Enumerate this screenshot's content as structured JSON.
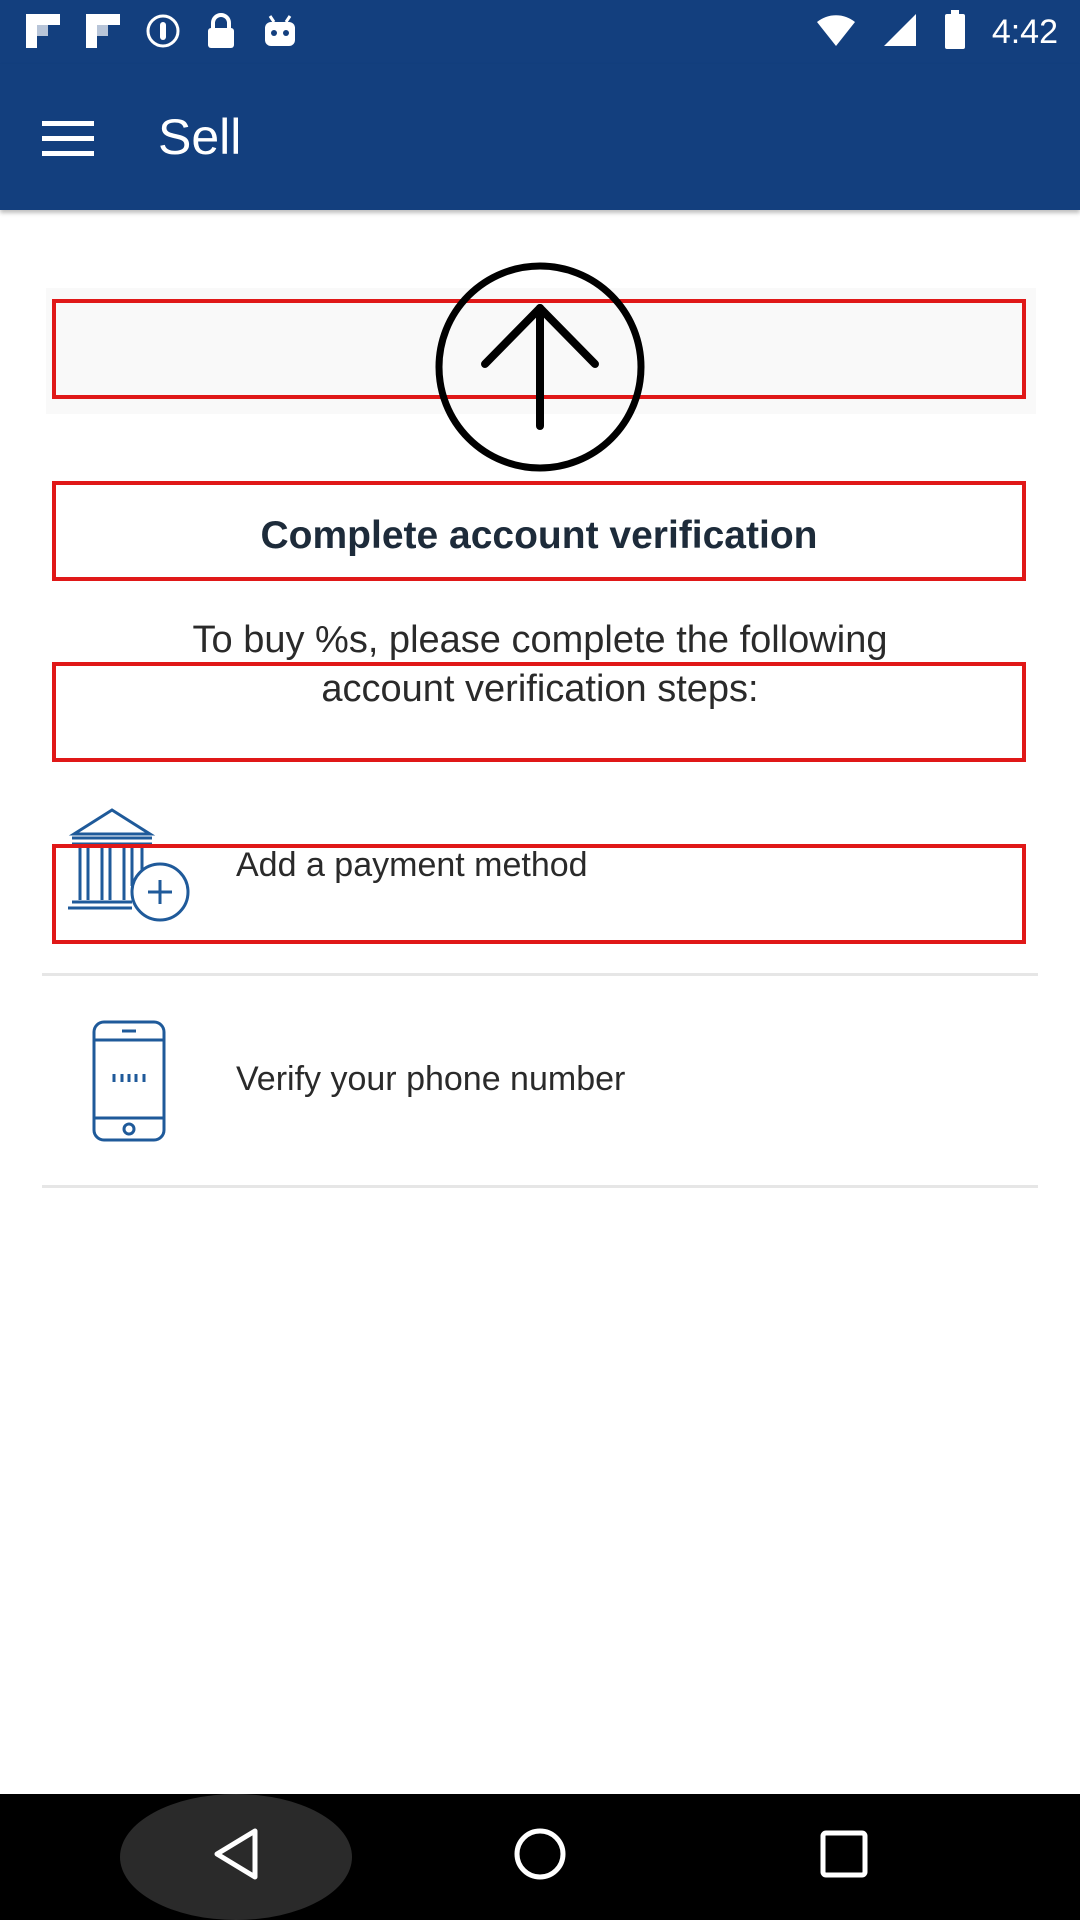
{
  "status_bar": {
    "time": "4:42",
    "left_icons": [
      "flipboard-icon",
      "flipboard-icon",
      "info-circle-icon",
      "lock-icon",
      "android-icon"
    ],
    "right_icons": [
      "wifi-icon",
      "signal-icon",
      "battery-icon"
    ]
  },
  "app_bar": {
    "title": "Sell",
    "menu_icon": "menu-icon",
    "background": "#133f7e"
  },
  "verification": {
    "icon": "upload-arrow-icon",
    "heading": "Complete account verification",
    "description_line1": "To buy %s, please complete the following",
    "description_line2": "account verification steps:",
    "steps": [
      {
        "label": "Add a payment method",
        "icon": "bank-add-icon"
      },
      {
        "label": "Verify your phone number",
        "icon": "phone-icon"
      }
    ]
  },
  "colors": {
    "accent_blue": "#133f7e",
    "icon_blue": "#1f5a9a",
    "highlight_red": "#e01818"
  },
  "nav_bar": {
    "buttons": [
      "back-icon",
      "home-icon",
      "recents-icon"
    ]
  }
}
